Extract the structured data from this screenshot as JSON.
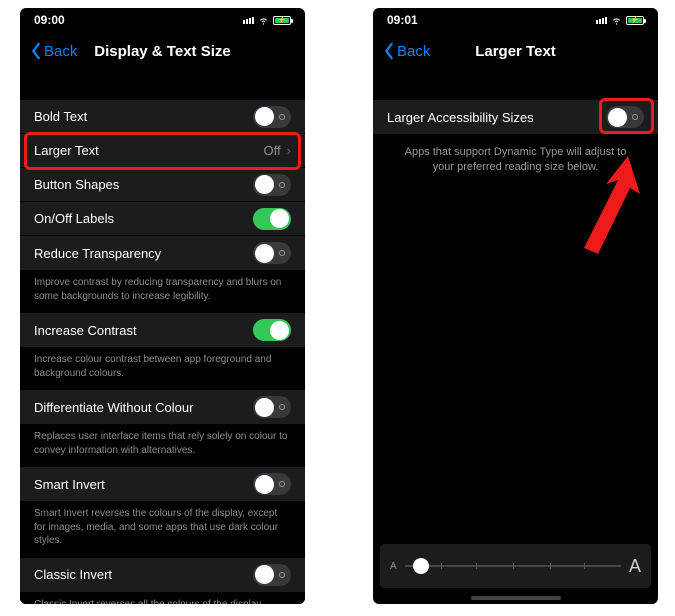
{
  "left": {
    "status_time": "09:00",
    "back_label": "Back",
    "title": "Display & Text Size",
    "rows": {
      "bold_text": "Bold Text",
      "larger_text": "Larger Text",
      "larger_text_value": "Off",
      "button_shapes": "Button Shapes",
      "onoff_labels": "On/Off Labels",
      "reduce_transparency": "Reduce Transparency",
      "increase_contrast": "Increase Contrast",
      "diff_without_colour": "Differentiate Without Colour",
      "smart_invert": "Smart Invert",
      "classic_invert": "Classic Invert"
    },
    "footers": {
      "transparency": "Improve contrast by reducing transparency and blurs on some backgrounds to increase legibility.",
      "contrast": "Increase colour contrast between app foreground and background colours.",
      "diff_colour": "Replaces user interface items that rely solely on colour to convey information with alternatives.",
      "smart_invert": "Smart Invert reverses the colours of the display, except for images, media, and some apps that use dark colour styles.",
      "classic_invert": "Classic Invert reverses all the colours of the display."
    },
    "toggle_states": {
      "bold_text": false,
      "button_shapes": false,
      "onoff_labels": true,
      "reduce_transparency": false,
      "increase_contrast": true,
      "diff_without_colour": false,
      "smart_invert": false,
      "classic_invert": false
    }
  },
  "right": {
    "status_time": "09:01",
    "back_label": "Back",
    "title": "Larger Text",
    "row_label": "Larger Accessibility Sizes",
    "toggle_state": false,
    "description": "Apps that support Dynamic Type will adjust to your preferred reading size below.",
    "slider": {
      "letter_small": "A",
      "letter_large": "A",
      "position_percent": 4,
      "ticks_percent": [
        17,
        33,
        50,
        67,
        83
      ]
    }
  },
  "colors": {
    "accent": "#0a84ff",
    "green": "#34c759",
    "highlight": "#ef1a1a"
  }
}
